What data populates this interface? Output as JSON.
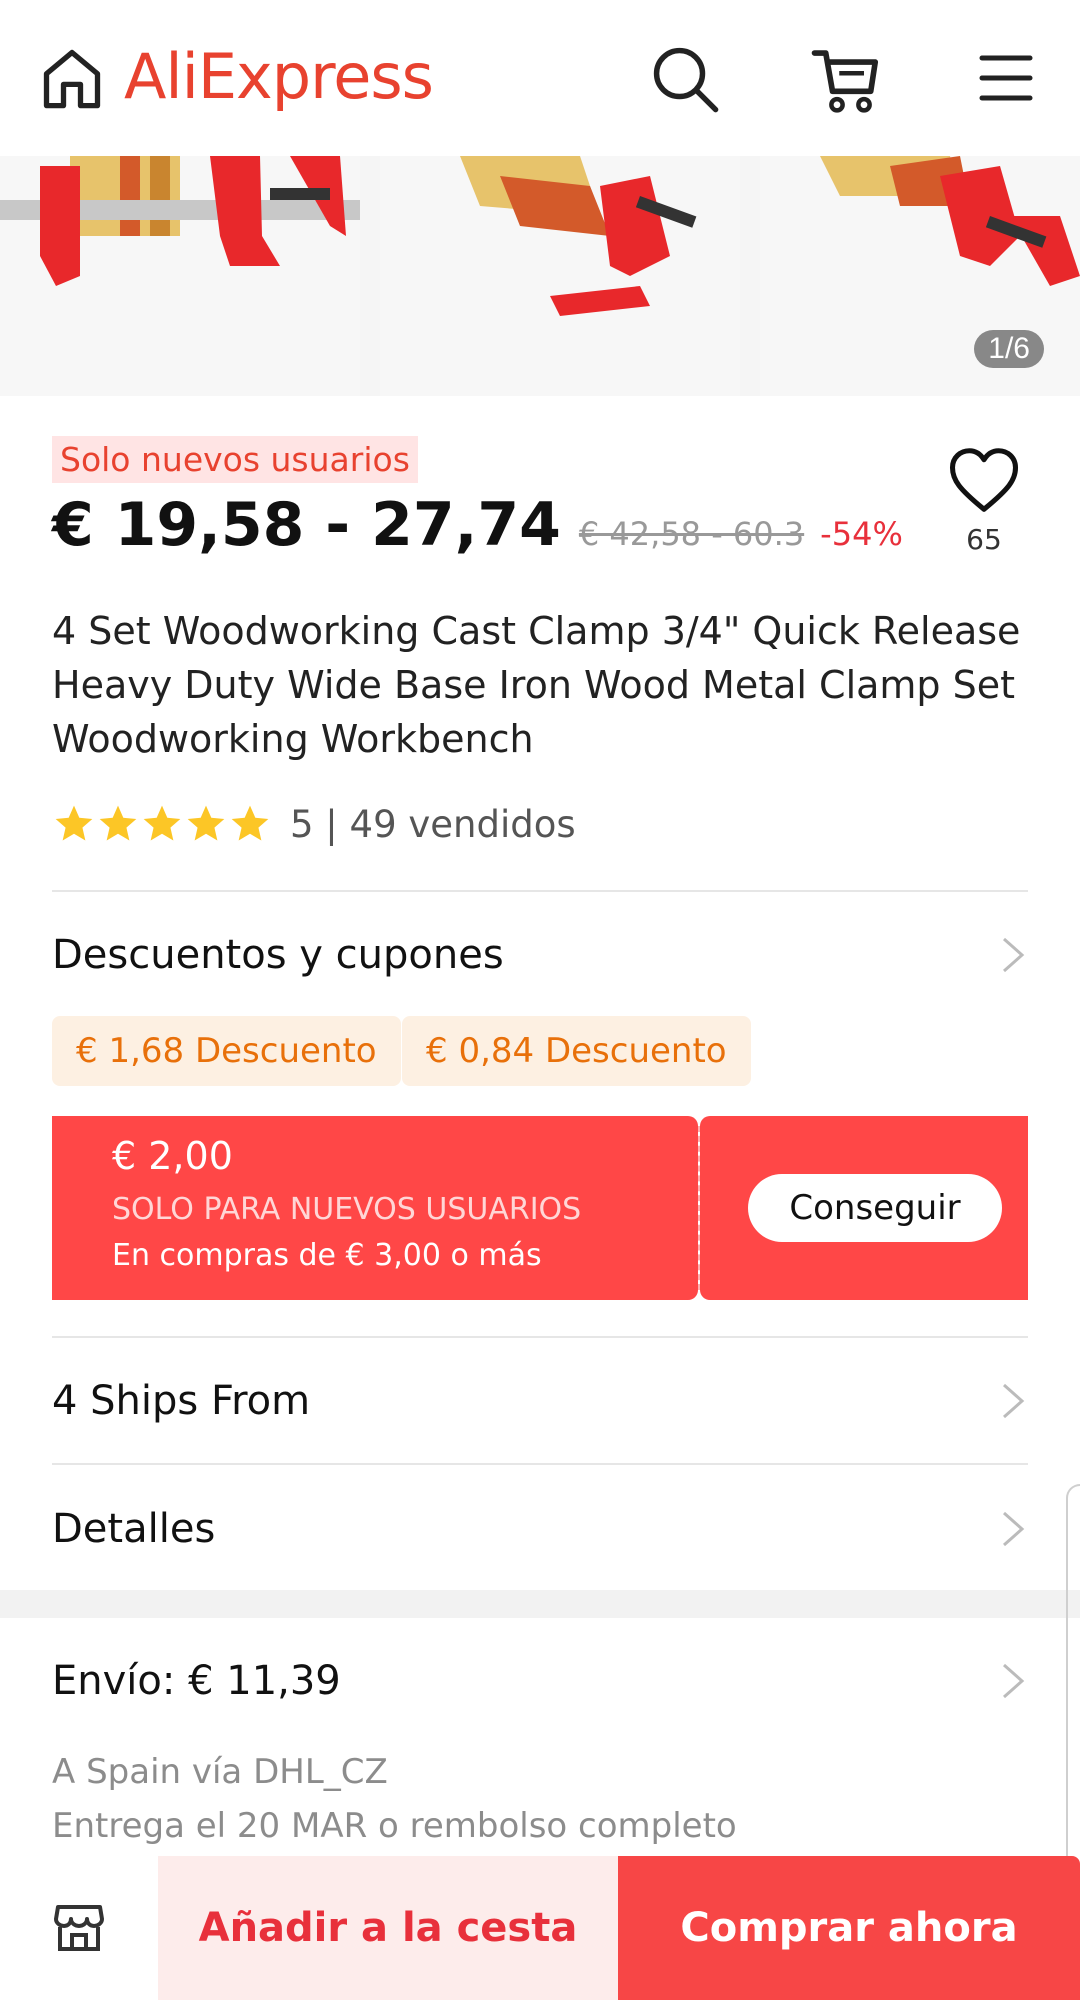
{
  "header": {
    "logo_text": "AliExpress",
    "icons": [
      "home-icon",
      "search-icon",
      "cart-icon",
      "menu-icon"
    ]
  },
  "gallery": {
    "pager": "1/6",
    "image_colors": {
      "clamp": "#e8282b",
      "wood_light": "#e7c36b",
      "wood_dark": "#d35a2a",
      "background": "#f5f5f5"
    }
  },
  "product": {
    "new_users_tag": "Solo nuevos usuarios",
    "price": "€ 19,58 - 27,74",
    "old_price": "€ 42,58 - 60.3",
    "discount_percent": "-54%",
    "wish_count": "65",
    "title": "4 Set Woodworking Cast Clamp 3/4\" Quick Release Heavy Duty Wide Base Iron Wood Metal Clamp Set Woodworking Workbench",
    "rating_stars": 5,
    "rating_text": "5 | 49 vendidos"
  },
  "discounts": {
    "label": "Descuentos y cupones",
    "chips": [
      "€ 1,68 Descuento",
      "€ 0,84 Descuento"
    ]
  },
  "coupon": {
    "amount": "€ 2,00",
    "title": "SOLO PARA NUEVOS USUARIOS",
    "condition": "En compras de € 3,00 o más",
    "button": "Conseguir"
  },
  "sections": {
    "ships_from": "4 Ships From",
    "details": "Detalles"
  },
  "shipping": {
    "label": "Envío: € 11,39",
    "route": "A Spain vía DHL_CZ",
    "delivery": "Entrega el 20 MAR o rembolso completo"
  },
  "bottom_bar": {
    "add_to_cart": "Añadir a la cesta",
    "buy_now": "Comprar ahora"
  },
  "colors": {
    "brand": "#e8422f",
    "coupon": "#ff4747",
    "discount_chip_bg": "#fdf0e2",
    "discount_chip_text": "#e8700a",
    "star": "#fcc626"
  }
}
